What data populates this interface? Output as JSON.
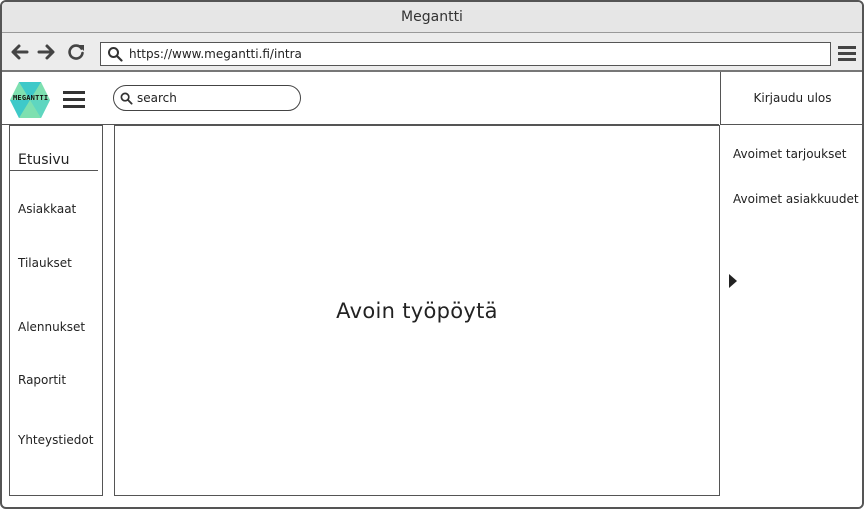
{
  "window": {
    "title": "Megantti"
  },
  "browser": {
    "back_icon": "arrow-left-icon",
    "forward_icon": "arrow-right-icon",
    "reload_icon": "reload-icon",
    "url": "https://www.megantti.fi/intra",
    "menu_icon": "hamburger-menu-icon"
  },
  "header": {
    "logo_text": "MEGANTTI",
    "search_placeholder": "search",
    "logout_label": "Kirjaudu ulos"
  },
  "sidebar": {
    "home": "Etusivu",
    "items": [
      {
        "label": "Asiakkaat"
      },
      {
        "label": "Tilaukset"
      },
      {
        "label": "Alennukset"
      },
      {
        "label": "Raportit"
      },
      {
        "label": "Yhteystiedot"
      }
    ]
  },
  "main": {
    "title": "Avoin työpöytä"
  },
  "right_panel": {
    "links": [
      {
        "label": "Avoimet tarjoukset"
      },
      {
        "label": "Avoimet asiakkuudet"
      }
    ],
    "expand_icon": "triangle-right-icon"
  },
  "colors": {
    "logo_teal": "#3ec9c9",
    "logo_green": "#7ee0b0",
    "border": "#555555",
    "titlebar_bg": "#e6e6e6"
  }
}
